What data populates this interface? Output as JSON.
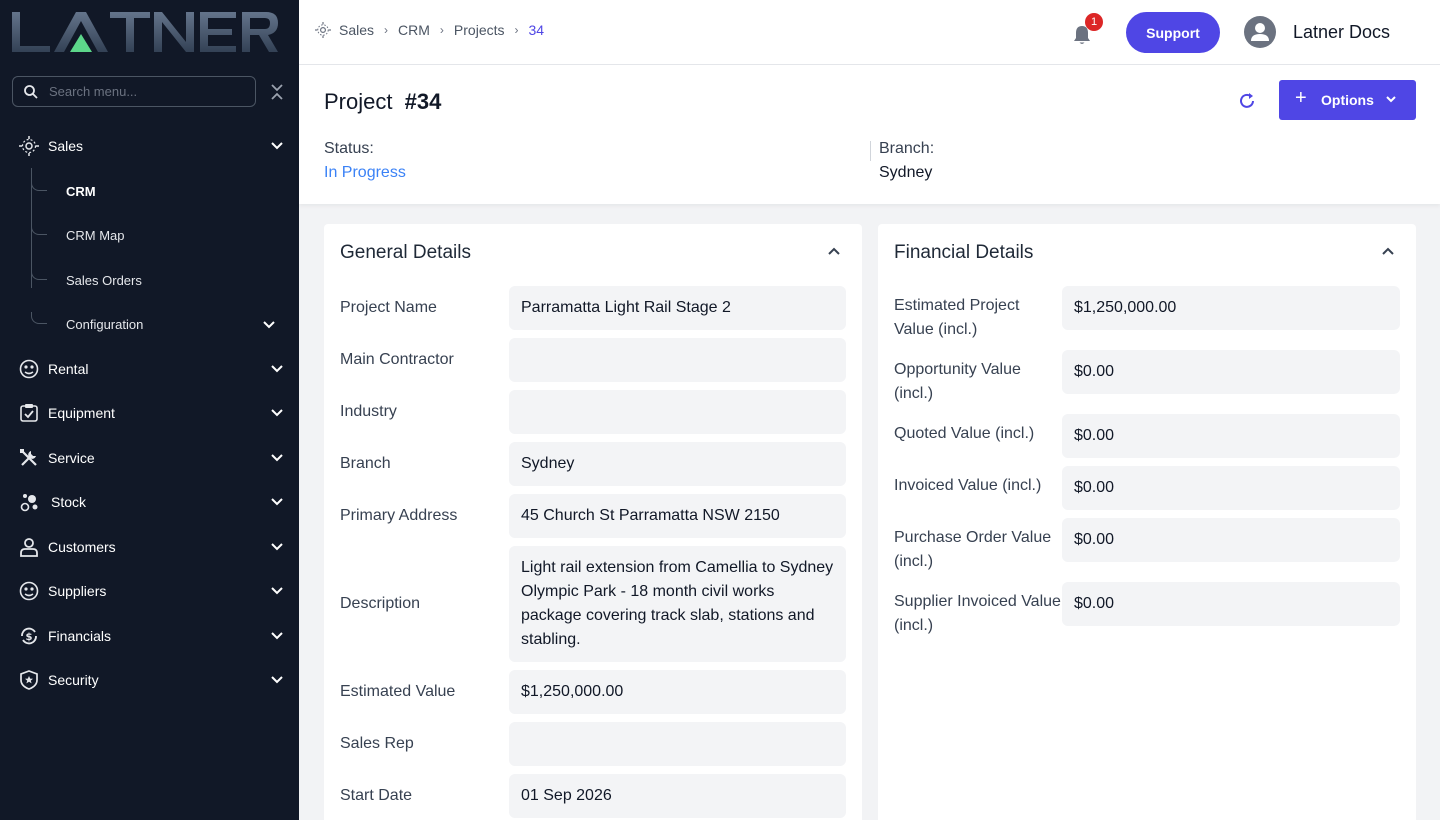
{
  "sidebar": {
    "logo_text": "LATNER",
    "search_placeholder": "Search menu...",
    "items": [
      {
        "label": "Sales",
        "icon": "sales-icon"
      },
      {
        "label": "Rental",
        "icon": "rental-icon"
      },
      {
        "label": "Equipment",
        "icon": "equipment-icon"
      },
      {
        "label": "Service",
        "icon": "service-icon"
      },
      {
        "label": "Stock",
        "icon": "stock-icon"
      },
      {
        "label": "Customers",
        "icon": "customers-icon"
      },
      {
        "label": "Suppliers",
        "icon": "suppliers-icon"
      },
      {
        "label": "Financials",
        "icon": "financials-icon"
      },
      {
        "label": "Security",
        "icon": "security-icon"
      }
    ],
    "sales_sub": [
      "CRM",
      "CRM Map",
      "Sales Orders",
      "Configuration"
    ]
  },
  "topbar": {
    "breadcrumbs": [
      "Sales",
      "CRM",
      "Projects",
      "34"
    ],
    "notification_count": "1",
    "support_label": "Support",
    "user_name": "Latner Docs"
  },
  "header": {
    "title": "Project",
    "number": "#34",
    "status_label": "Status:",
    "status_value": "In Progress",
    "branch_label": "Branch:",
    "branch_value": "Sydney",
    "options_label": "Options"
  },
  "general": {
    "title": "General Details",
    "rows": [
      {
        "label": "Project Name",
        "value": "Parramatta Light Rail Stage 2"
      },
      {
        "label": "Main Contractor",
        "value": ""
      },
      {
        "label": "Industry",
        "value": ""
      },
      {
        "label": "Branch",
        "value": "Sydney"
      },
      {
        "label": "Primary Address",
        "value": "45 Church St Parramatta NSW 2150"
      },
      {
        "label": "Description",
        "value": "Light rail extension from Camellia to Sydney Olympic Park - 18 month civil works package covering track slab, stations and stabling."
      },
      {
        "label": "Estimated Value",
        "value": "$1,250,000.00"
      },
      {
        "label": "Sales Rep",
        "value": ""
      },
      {
        "label": "Start Date",
        "value": "01 Sep 2026"
      }
    ]
  },
  "financial": {
    "title": "Financial Details",
    "rows": [
      {
        "label": "Estimated Project Value (incl.)",
        "value": "$1,250,000.00"
      },
      {
        "label": "Opportunity Value (incl.)",
        "value": "$0.00"
      },
      {
        "label": "Quoted Value (incl.)",
        "value": "$0.00"
      },
      {
        "label": "Invoiced Value (incl.)",
        "value": "$0.00"
      },
      {
        "label": "Purchase Order Value (incl.)",
        "value": "$0.00"
      },
      {
        "label": "Supplier Invoiced Value (incl.)",
        "value": "$0.00"
      }
    ]
  },
  "colors": {
    "sidebar_bg": "#111827",
    "accent": "#4f46e5",
    "status": "#3b82f6",
    "badge": "#dc2626"
  }
}
